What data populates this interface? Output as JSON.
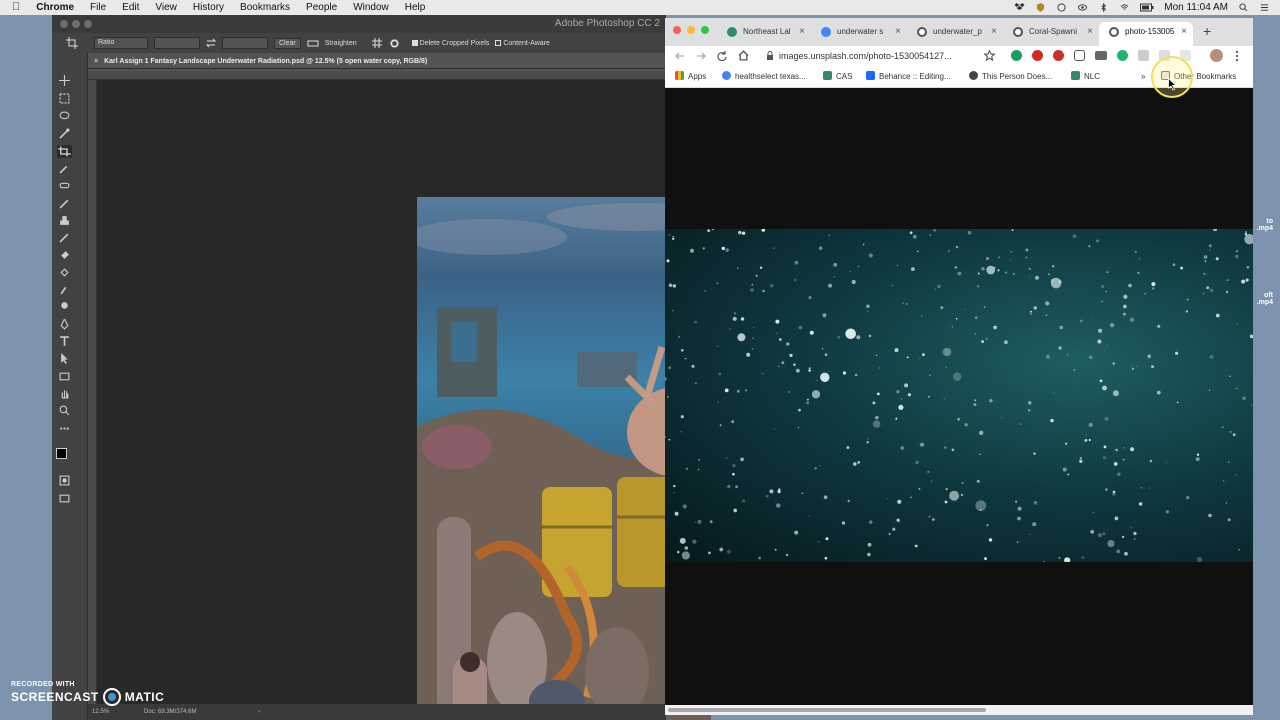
{
  "menubar": {
    "items": [
      "Chrome",
      "File",
      "Edit",
      "View",
      "History",
      "Bookmarks",
      "People",
      "Window",
      "Help"
    ],
    "clock": "Mon 11:04 AM"
  },
  "photoshop": {
    "title": "Adobe Photoshop CC 2",
    "options": {
      "ratio": "Ratio",
      "clear": "Clear",
      "straighten": "Straighten",
      "delete_cropped": "Delete Cropped Pixels",
      "content_aware": "Content-Aware"
    },
    "doc_tab": "Karl Assign 1 Fantasy Landscape Underwater Radiation.psd @ 12.5% (5 open water copy, RGB/8)",
    "status": {
      "zoom": "12.5%",
      "doc": "Doc: 69.3M/374.6M"
    }
  },
  "chrome": {
    "tabs": [
      {
        "label": "Northeast Lal",
        "color": "#2f8c6f"
      },
      {
        "label": "underwater s",
        "color": "#4285f4"
      },
      {
        "label": "underwater_p",
        "color": "#666666"
      },
      {
        "label": "Coral-Spawni",
        "color": "#666666"
      },
      {
        "label": "photo-153005",
        "color": "#666666"
      }
    ],
    "url": "images.unsplash.com/photo-1530054127...",
    "bookmarks": [
      {
        "label": "Apps",
        "color": "#e84c3d"
      },
      {
        "label": "healthselect texas...",
        "color": "#4285f4"
      },
      {
        "label": "CAS",
        "color": "#2f8c6f"
      },
      {
        "label": "Behance :: Editing...",
        "color": "#1769ff"
      },
      {
        "label": "This Person Does...",
        "color": "#444444"
      },
      {
        "label": "NLC",
        "color": "#2f8c6f"
      }
    ],
    "more": "»",
    "other_bookmarks": "Other Bookmarks"
  },
  "desktop": {
    "file1_line1": "to",
    "file1_line2": ".mp4",
    "file2_line1": "oft",
    "file2_line2": ".mp4"
  },
  "watermark": {
    "line1": "RECORDED WITH",
    "line2a": "SCREENCAST",
    "line2b": "MATIC"
  }
}
